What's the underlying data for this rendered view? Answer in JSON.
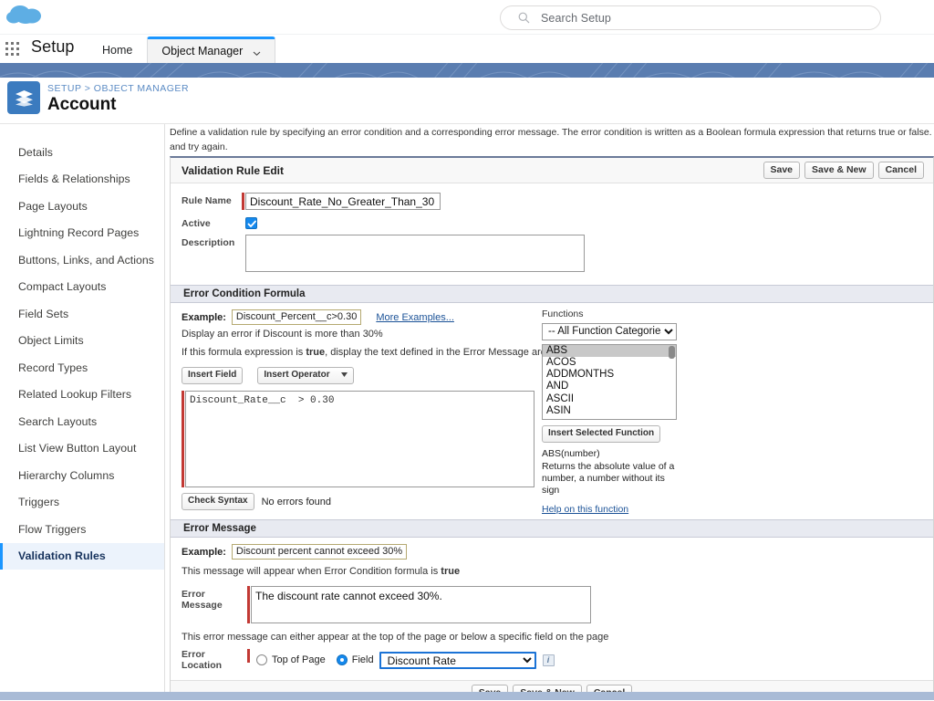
{
  "global_header": {
    "logo_name": "salesforce-cloud-logo",
    "search": {
      "placeholder": "Search Setup",
      "value": "",
      "icon": "search-icon"
    }
  },
  "setup_bar": {
    "app_launcher_icon": "app-launcher-waffle-icon",
    "title": "Setup",
    "tabs": [
      {
        "label": "Home",
        "active": false,
        "has_chevron": false
      },
      {
        "label": "Object Manager",
        "active": true,
        "has_chevron": true,
        "chevron_icon": "chevron-down-icon"
      }
    ]
  },
  "object_header": {
    "icon": "account-object-icon",
    "breadcrumb": "SETUP > OBJECT MANAGER",
    "title": "Account"
  },
  "sidebar": {
    "items": [
      {
        "label": "Details",
        "selected": false
      },
      {
        "label": "Fields & Relationships",
        "selected": false
      },
      {
        "label": "Page Layouts",
        "selected": false
      },
      {
        "label": "Lightning Record Pages",
        "selected": false
      },
      {
        "label": "Buttons, Links, and Actions",
        "selected": false
      },
      {
        "label": "Compact Layouts",
        "selected": false
      },
      {
        "label": "Field Sets",
        "selected": false
      },
      {
        "label": "Object Limits",
        "selected": false
      },
      {
        "label": "Record Types",
        "selected": false
      },
      {
        "label": "Related Lookup Filters",
        "selected": false
      },
      {
        "label": "Search Layouts",
        "selected": false
      },
      {
        "label": "List View Button Layout",
        "selected": false
      },
      {
        "label": "Hierarchy Columns",
        "selected": false
      },
      {
        "label": "Triggers",
        "selected": false
      },
      {
        "label": "Flow Triggers",
        "selected": false
      },
      {
        "label": "Validation Rules",
        "selected": true
      }
    ]
  },
  "main": {
    "intro_line1": "Define a validation rule by specifying an error condition and a corresponding error message. The error condition is written as a Boolean formula expression that returns true or false. When the form",
    "intro_line2": "and try again.",
    "page_block": {
      "title": "Validation Rule Edit",
      "buttons": [
        {
          "label": "Save",
          "name": "save-button"
        },
        {
          "label": "Save & New",
          "name": "save-and-new-button"
        },
        {
          "label": "Cancel",
          "name": "cancel-button"
        }
      ],
      "footer_buttons": [
        {
          "label": "Save",
          "name": "save-button-footer"
        },
        {
          "label": "Save & New",
          "name": "save-and-new-button-footer"
        },
        {
          "label": "Cancel",
          "name": "cancel-button-footer"
        }
      ]
    },
    "fields": {
      "rule_name": {
        "label": "Rule Name",
        "value": "Discount_Rate_No_Greater_Than_30",
        "required": true
      },
      "active": {
        "label": "Active",
        "checked": true
      },
      "description": {
        "label": "Description",
        "value": "",
        "required": false
      }
    },
    "error_condition_formula": {
      "section_title": "Error Condition Formula",
      "example_label": "Example:",
      "example_value": "Discount_Percent__c>0.30",
      "more_examples_link": "More Examples...",
      "example_note": "Display an error if Discount is more than 30%",
      "true_note_before": "If this formula expression is ",
      "true_note_bold": "true",
      "true_note_after": ", display the text defined in the Error Message area",
      "insert_field_button": "Insert Field",
      "insert_operator_button": "Insert Operator",
      "formula_value": "Discount_Rate__c  > 0.30",
      "check_syntax_button": "Check Syntax",
      "syntax_message": "No errors found"
    },
    "functions_panel": {
      "label": "Functions",
      "category_selected": "-- All Function Categories --",
      "options": [
        "ABS",
        "ACOS",
        "ADDMONTHS",
        "AND",
        "ASCII",
        "ASIN"
      ],
      "selected_option": "ABS",
      "insert_button": "Insert Selected Function",
      "signature": "ABS(number)",
      "description": "Returns the absolute value of a number, a number without its sign",
      "help_link": "Help on this function"
    },
    "error_message_section": {
      "section_title": "Error Message",
      "example_label": "Example:",
      "example_value": "Discount percent cannot exceed 30%",
      "appear_note_before": "This message will appear when Error Condition formula is ",
      "appear_note_bold": "true",
      "error_message_label": "Error Message",
      "error_message_value": "The discount rate cannot exceed 30%.",
      "location_note": "This error message can either appear at the top of the page or below a specific field on the page",
      "error_location_label": "Error Location",
      "radio_top_of_page": {
        "label": "Top of Page",
        "selected": false
      },
      "radio_field": {
        "label": "Field",
        "selected": true
      },
      "field_select_value": "Discount Rate",
      "info_icon": "info-icon"
    }
  },
  "colors": {
    "brand_blue": "#1b96ff",
    "banner_blue": "#5a7db0",
    "required_red": "#c23934",
    "link_blue": "#1b5297",
    "selected_nav_bg": "#ecf3fc"
  }
}
